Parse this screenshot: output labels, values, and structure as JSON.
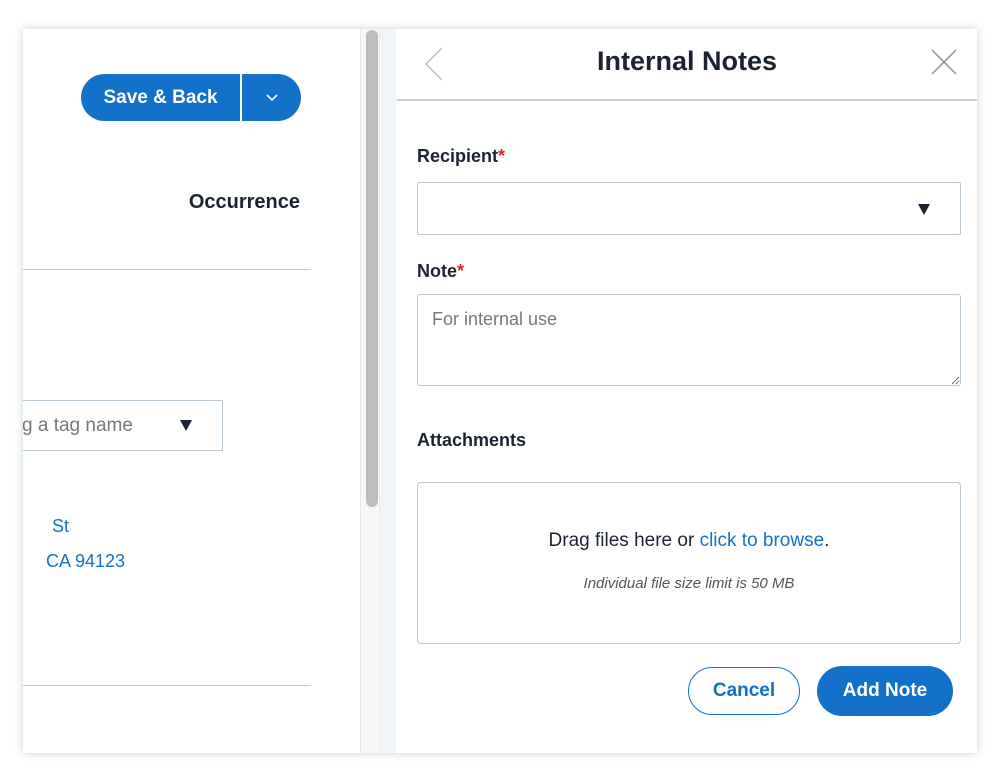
{
  "left_pane": {
    "save_back_label": "Save & Back",
    "save_options_icon": "chevron-down-icon",
    "section_heading": "Occurrence",
    "tag_select_placeholder": "g a tag name",
    "tag_select_icon": "triangle-down-icon",
    "address_line_1": "St",
    "address_line_2": "CA 94123"
  },
  "drawer": {
    "title": "Internal Notes",
    "back_icon": "chevron-left-icon",
    "close_icon": "close-icon",
    "recipient": {
      "label": "Recipient",
      "required_marker": "*",
      "value": ""
    },
    "note": {
      "label": "Note",
      "required_marker": "*",
      "value": "",
      "placeholder": "For internal use"
    },
    "attachments": {
      "label": "Attachments",
      "drop_text": "Drag files here or ",
      "browse_link": "click to browse",
      "drop_text_end": ".",
      "size_limit": "Individual file size limit is 50 MB"
    },
    "buttons": {
      "cancel": "Cancel",
      "add_note": "Add Note"
    }
  },
  "colors": {
    "accent": "#1471c9",
    "required": "#e32222",
    "text": "#1b2333",
    "border": "#b9c8d2"
  }
}
